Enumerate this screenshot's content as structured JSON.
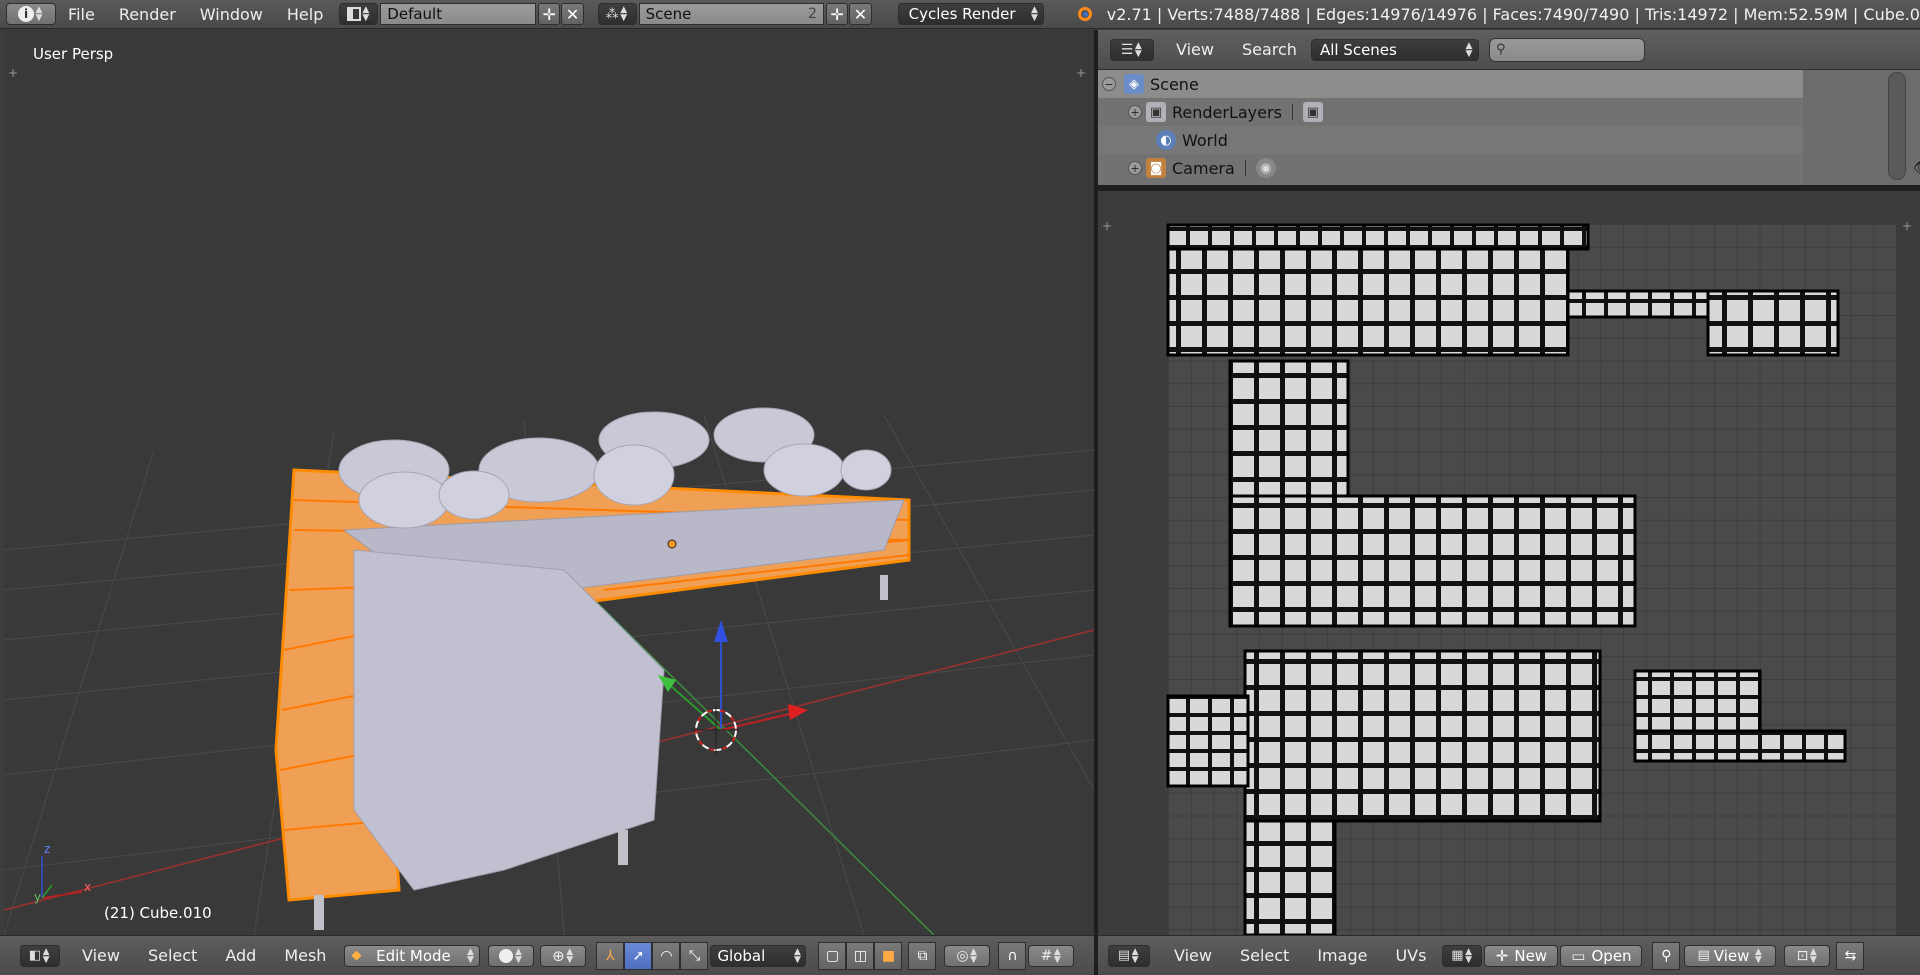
{
  "topbar": {
    "info_icon": "info-icon",
    "menus": [
      "File",
      "Render",
      "Window",
      "Help"
    ],
    "layout": "Default",
    "scene": "Scene",
    "scene_users": "2",
    "engine": "Cycles Render",
    "stats": "v2.71 | Verts:7488/7488 | Edges:14976/14976 | Faces:7490/7490 | Tris:14972 | Mem:52.59M | Cube.0"
  },
  "viewport": {
    "view_label": "User Persp",
    "object_label": "(21) Cube.010",
    "axis": {
      "x": "x",
      "y": "y",
      "z": "z"
    }
  },
  "bottom_left": {
    "menus": [
      "View",
      "Select",
      "Add",
      "Mesh"
    ],
    "mode": "Edit Mode",
    "orientation": "Global"
  },
  "outliner": {
    "header": {
      "view": "View",
      "search": "Search",
      "filter": "All Scenes"
    },
    "rows": [
      {
        "label": "Scene"
      },
      {
        "label": "RenderLayers"
      },
      {
        "label": "World"
      },
      {
        "label": "Camera"
      }
    ]
  },
  "bottom_right": {
    "menus": [
      "View",
      "Select",
      "Image",
      "UVs"
    ],
    "new_label": "New",
    "open_label": "Open",
    "view_label": "View"
  },
  "colors": {
    "accent_orange": "#ff9a1e",
    "selected_blue": "#5a7bd0",
    "bg_viewport": "#393939"
  }
}
